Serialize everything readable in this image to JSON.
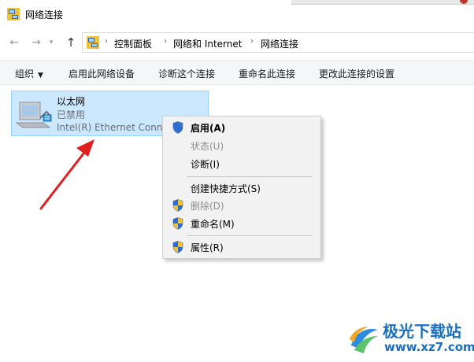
{
  "window": {
    "title": "网络连接",
    "icon": "network-connections-icon"
  },
  "address": {
    "back_icon": "arrow-left-icon",
    "forward_icon": "arrow-right-icon",
    "dropdown_icon": "chevron-down-icon",
    "up_icon": "arrow-up-icon",
    "breadcrumb": [
      "控制面板",
      "网络和 Internet",
      "网络连接"
    ]
  },
  "toolbar": {
    "organize": "组织",
    "enable_device": "启用此网络设备",
    "diagnose": "诊断这个连接",
    "rename": "重命名此连接",
    "change_settings": "更改此连接的设置"
  },
  "connection": {
    "name": "以太网",
    "status": "已禁用",
    "device": "Intel(R) Ethernet Connection",
    "icon": "ethernet-adapter-icon"
  },
  "context_menu": {
    "items": [
      {
        "label": "启用(A)",
        "shield": true,
        "bold": true,
        "enabled": true
      },
      {
        "label": "状态(U)",
        "shield": false,
        "bold": false,
        "enabled": false
      },
      {
        "label": "诊断(I)",
        "shield": false,
        "bold": false,
        "enabled": true
      },
      {
        "label": "创建快捷方式(S)",
        "shield": false,
        "bold": false,
        "enabled": true
      },
      {
        "label": "删除(D)",
        "shield": true,
        "bold": false,
        "enabled": false
      },
      {
        "label": "重命名(M)",
        "shield": true,
        "bold": false,
        "enabled": true
      },
      {
        "label": "属性(R)",
        "shield": true,
        "bold": false,
        "enabled": true
      }
    ]
  },
  "watermark": {
    "brand": "极光下载站",
    "site": "www.xz7.com"
  },
  "colors": {
    "selection": "#cce8ff",
    "selection_border": "#99d1ff",
    "arrow": "#e02020",
    "brand": "#1a6fc0"
  }
}
